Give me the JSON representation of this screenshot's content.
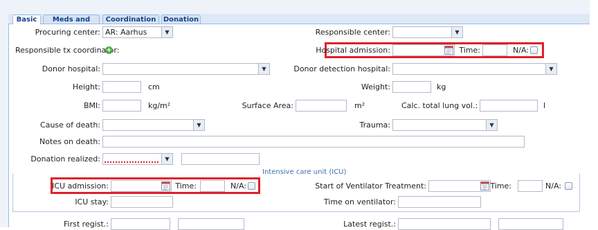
{
  "tabs": [
    "Basic",
    "Meds and labs",
    "Coordination",
    "Donation"
  ],
  "form": {
    "procuring_center_label": "Procuring center:",
    "procuring_center_value": "AR: Aarhus",
    "responsible_center_label": "Responsible center:",
    "responsible_center_value": "",
    "responsible_tx_coordinator_label": "Responsible tx coordinator:",
    "hospital_admission_label": "Hospital admission:",
    "hospital_admission_value": "",
    "time_label": "Time:",
    "hospital_admission_time_value": "",
    "na_label": "N/A:",
    "donor_hospital_label": "Donor hospital:",
    "donor_hospital_value": "",
    "donor_detection_hospital_label": "Donor detection hospital:",
    "donor_detection_hospital_value": "",
    "height_label": "Height:",
    "height_value": "",
    "height_unit": "cm",
    "weight_label": "Weight:",
    "weight_value": "",
    "weight_unit": "kg",
    "bmi_label": "BMI:",
    "bmi_value": "",
    "bmi_unit": "kg/m²",
    "surface_area_label": "Surface Area:",
    "surface_area_value": "",
    "surface_area_unit": "m²",
    "calc_total_lung_vol_label": "Calc. total lung vol.:",
    "calc_total_lung_vol_value": "",
    "calc_total_lung_vol_unit": "l",
    "cause_of_death_label": "Cause of death:",
    "cause_of_death_value": "",
    "trauma_label": "Trauma:",
    "trauma_value": "",
    "notes_on_death_label": "Notes on death:",
    "notes_on_death_value": "",
    "donation_realized_label": "Donation realized:",
    "donation_realized_value": "",
    "donation_realized_extra_value": ""
  },
  "icu": {
    "section_title": "Intensive care unit (ICU)",
    "icu_admission_label": "ICU admission:",
    "icu_admission_value": "",
    "time_label": "Time:",
    "icu_admission_time_value": "",
    "na_label": "N/A:",
    "start_ventilator_label": "Start of Ventilator Treatment:",
    "start_ventilator_value": "",
    "start_ventilator_time_value": "",
    "icu_stay_label": "ICU stay:",
    "icu_stay_value": "",
    "time_on_ventilator_label": "Time on ventilator:",
    "time_on_ventilator_value": ""
  },
  "regist": {
    "first_regist_label": "First regist.:",
    "first_regist_date": "",
    "first_regist_time": "",
    "latest_regist_label": "Latest regist.:",
    "latest_regist_date": "",
    "latest_regist_time": ""
  },
  "icons": {
    "combo_arrow": "▼",
    "add": "+"
  },
  "colors": {
    "highlight": "#e0202a",
    "tab_text": "#15428b",
    "add_icon": "#55a84a",
    "section_title": "#3f6fb0"
  }
}
